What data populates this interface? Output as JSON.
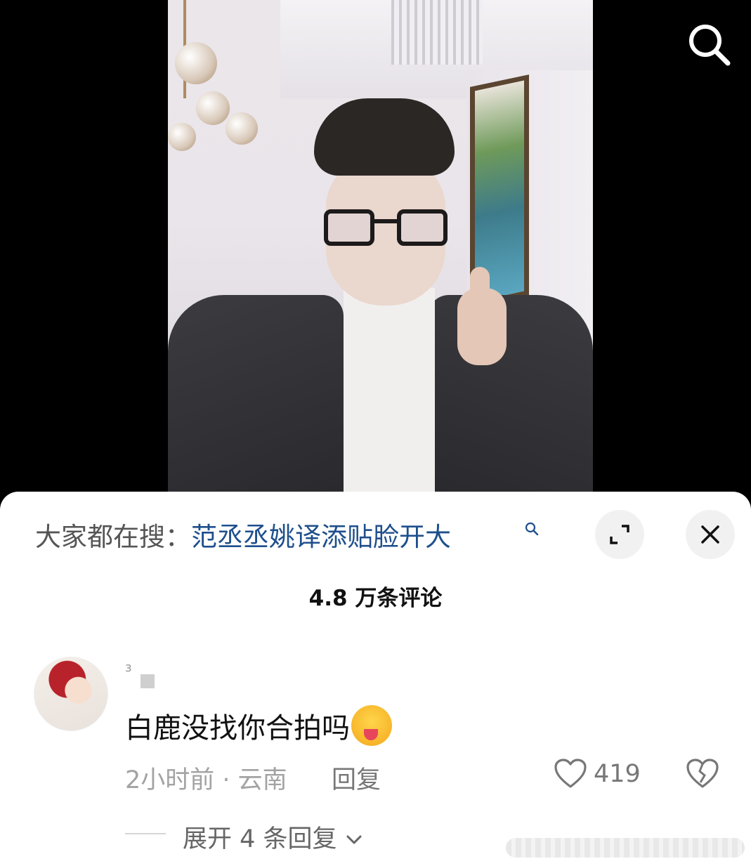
{
  "hot_search": {
    "prefix": "大家都在搜：",
    "query": "范丞丞姚译添贴脸开大"
  },
  "comments_header": {
    "count_label": "4.8 万条评论"
  },
  "comment": {
    "username": "ɜ",
    "text": "白鹿没找你合拍吗",
    "emoji_icon": "winking-tongue-face-emoji",
    "meta": "2小时前 · 云南",
    "reply_label": "回复",
    "like_count": "419",
    "expand_label": "展开 4 条回复"
  },
  "colors": {
    "link": "#1e4f8c",
    "sheet_bg": "#ffffff",
    "muted_text": "#a3a3a3"
  }
}
